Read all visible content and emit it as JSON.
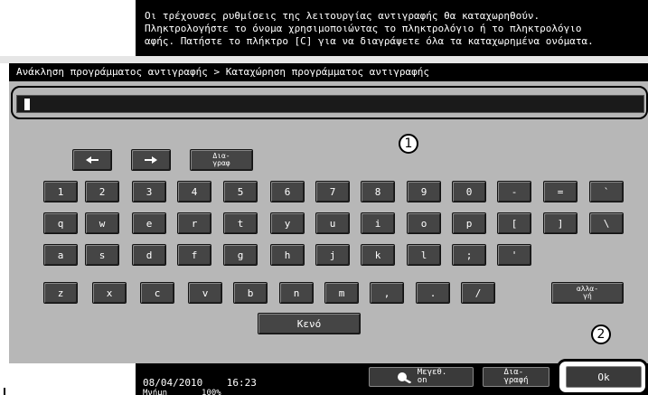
{
  "message": {
    "lines": [
      "Οι τρέχουσες ρυθμίσεις της λειτουργίας αντιγραφής θα καταχωρηθούν.",
      "Πληκτρολογήστε το όνομα χρησιμοποιώντας το πληκτρολόγιο ή το πληκτρολόγιο",
      "αφής. Πατήστε το πλήκτρο [C] για να διαγράψετε όλα τα καταχωρημένα ονόματα."
    ]
  },
  "breadcrumb": "Ανάκληση προγράμματος αντιγραφής > Καταχώρηση προγράμματος αντιγραφής",
  "input": {
    "value": ""
  },
  "callouts": {
    "one": "1",
    "two": "2"
  },
  "keys": {
    "delete": "Δια-\nγραφ",
    "row1": [
      "1",
      "2",
      "3",
      "4",
      "5",
      "6",
      "7",
      "8",
      "9",
      "0",
      "-",
      "=",
      "`"
    ],
    "row2": [
      "q",
      "w",
      "e",
      "r",
      "t",
      "y",
      "u",
      "i",
      "o",
      "p",
      "[",
      "]",
      "\\"
    ],
    "row3": [
      "a",
      "s",
      "d",
      "f",
      "g",
      "h",
      "j",
      "k",
      "l",
      ";",
      "'"
    ],
    "row4": [
      "z",
      "x",
      "c",
      "v",
      "b",
      "n",
      "m",
      ",",
      ".",
      "/"
    ],
    "shift": "αλλα-\nγή",
    "space": "Κενό"
  },
  "status": {
    "datetime": "08/04/2010    16:23",
    "memory": "Μνήμη       100%"
  },
  "bottom": {
    "enlarge": "Μεγεθ.\nοn",
    "delete": "Δια-\nγραφή",
    "ok": "Ok"
  }
}
